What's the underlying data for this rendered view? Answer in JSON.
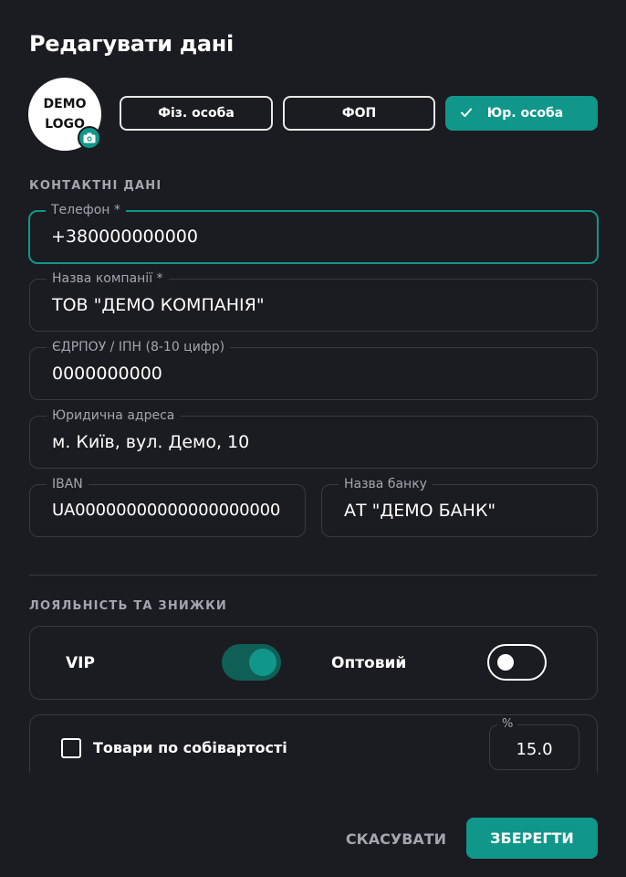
{
  "dialog": {
    "title": "Редагувати дані"
  },
  "logo": {
    "line1": "DEMO",
    "line2": "LOGO",
    "camera_icon": "camera-icon"
  },
  "client_types": [
    {
      "label": "Фіз. особа",
      "selected": false
    },
    {
      "label": "ФОП",
      "selected": false
    },
    {
      "label": "Юр. особа",
      "selected": true
    }
  ],
  "contacts": {
    "section_title": "КОНТАКТНІ ДАНІ",
    "phone": {
      "label": "Телефон *",
      "value": "+380000000000"
    },
    "company": {
      "label": "Назва компанії *",
      "value": "ТОВ \"ДЕМО КОМПАНІЯ\""
    },
    "edrpou": {
      "label": "ЄДРПОУ / ІПН (8-10 цифр)",
      "value": "0000000000"
    },
    "address": {
      "label": "Юридична адреса",
      "value": "м. Київ, вул. Демо, 10"
    },
    "iban": {
      "label": "IBAN",
      "value": "UA00000000000000000000"
    },
    "bank": {
      "label": "Назва банку",
      "value": "АТ \"ДЕМО БАНК\""
    }
  },
  "loyalty": {
    "section_title": "ЛОЯЛЬНІСТЬ ТА ЗНИЖКИ",
    "vip": {
      "label": "VIP",
      "on": true
    },
    "wholesale": {
      "label": "Оптовий",
      "on": false
    },
    "cost_price": {
      "label": "Товари по собівартості",
      "checked": false
    },
    "discount": {
      "label": "%",
      "value": "15.0"
    }
  },
  "actions": {
    "cancel": "СКАСУВАТИ",
    "save": "ЗБЕРЕГТИ"
  },
  "colors": {
    "accent": "#10978a",
    "background": "#1b1c21",
    "border": "#383a41",
    "muted_text": "#a3a6ad"
  }
}
